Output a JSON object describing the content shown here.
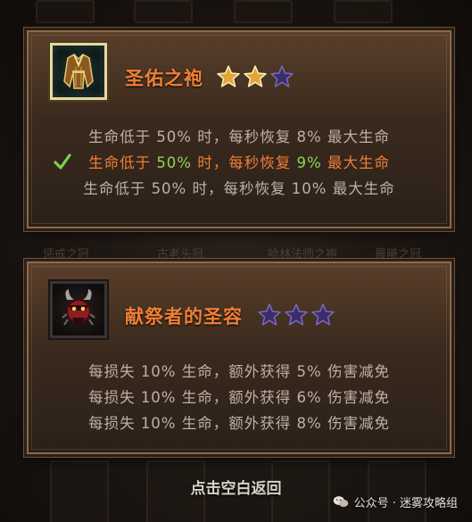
{
  "background": {
    "slot_labels": [
      "惩戒之冠",
      "古老头冠",
      "哈林法师之袍",
      "晨曦之冠"
    ]
  },
  "items": [
    {
      "name": "圣佑之袍",
      "icon": "golden-robe-icon",
      "stars_filled": 2,
      "stars_total": 3,
      "effects": [
        {
          "parts": [
            "生命低于",
            "50%",
            "时，每秒恢复",
            "8%",
            "最大生命"
          ],
          "active": false
        },
        {
          "parts": [
            "生命低于",
            "50%",
            "时，每秒恢复",
            "9%",
            "最大生命"
          ],
          "active": true
        },
        {
          "parts": [
            "生命低于",
            "50%",
            "时，每秒恢复",
            "10%",
            "最大生命"
          ],
          "active": false
        }
      ]
    },
    {
      "name": "献祭者的圣容",
      "icon": "horned-demon-mask-icon",
      "stars_filled": 0,
      "stars_total": 3,
      "effects": [
        {
          "parts": [
            "每损失",
            "10%",
            "生命，额外获得",
            "5%",
            "伤害减免"
          ],
          "active": false
        },
        {
          "parts": [
            "每损失",
            "10%",
            "生命，额外获得",
            "6%",
            "伤害减免"
          ],
          "active": false
        },
        {
          "parts": [
            "每损失",
            "10%",
            "生命，额外获得",
            "8%",
            "伤害减免"
          ],
          "active": false
        }
      ]
    }
  ],
  "back_hint": "点击空白返回",
  "watermark": {
    "text": "公众号 · 迷雾攻略组",
    "icon": "wechat-icon"
  },
  "colors": {
    "title_orange": "#f07f35",
    "active_orange": "#f07f35",
    "highlight_green": "#8fd659",
    "inactive_text": "#bdb2a6",
    "star_gold": "#e0a43a",
    "star_empty": "#3a2d6a",
    "check_green": "#7cd34a"
  }
}
